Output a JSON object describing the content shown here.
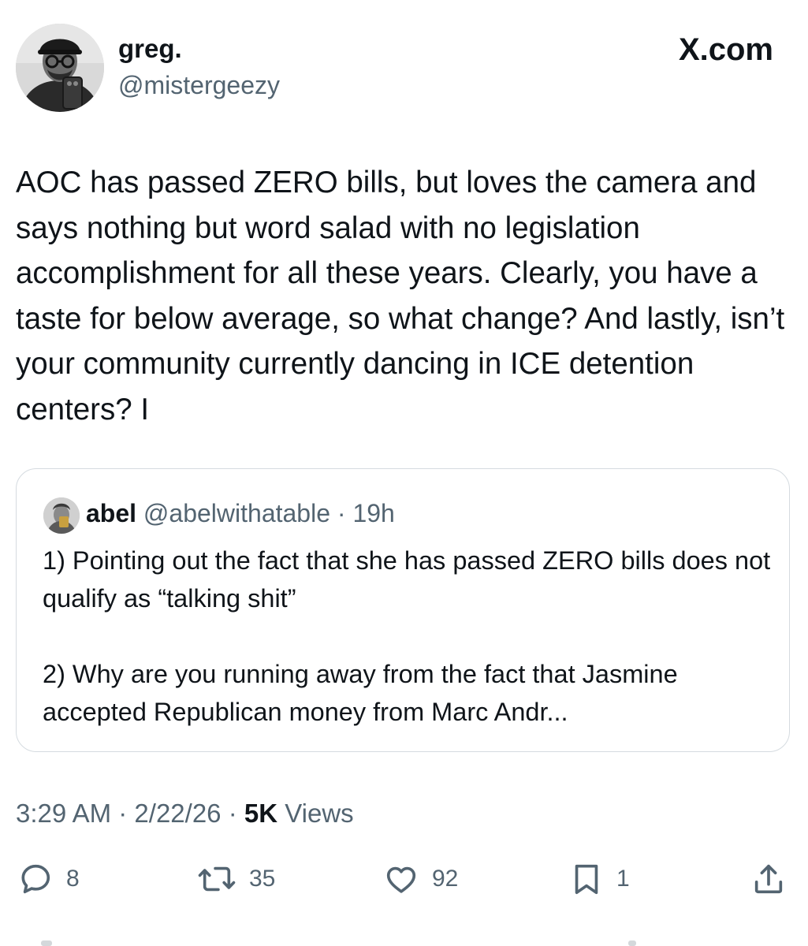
{
  "author": {
    "display_name": "greg.",
    "handle": "@mistergeezy"
  },
  "brand": "X.com",
  "tweet": {
    "text": "AOC has passed ZERO bills, but loves the camera and says nothing but word salad with no legislation accomplishment for all these years. Clearly, you have a taste for below average, so what change? And lastly, isn’t your community currently dancing in ICE detention centers? I"
  },
  "quote": {
    "display_name": "abel",
    "handle": "@abelwithatable",
    "separator": "·",
    "time": "19h",
    "paragraph_1": "1) Pointing out the fact that she has passed ZERO bills does not qualify as “talking shit”",
    "paragraph_2": "2) Why are you running away from the fact that Jasmine accepted Republican money from Marc Andr..."
  },
  "meta": {
    "time": "3:29 AM",
    "separator": "·",
    "date": "2/22/26",
    "views_count": "5K",
    "views_label": "Views"
  },
  "actions": {
    "replies": "8",
    "reposts": "35",
    "likes": "92",
    "bookmarks": "1"
  },
  "colors": {
    "text": "#0f1419",
    "secondary": "#536471",
    "border": "#d5dbe0"
  }
}
